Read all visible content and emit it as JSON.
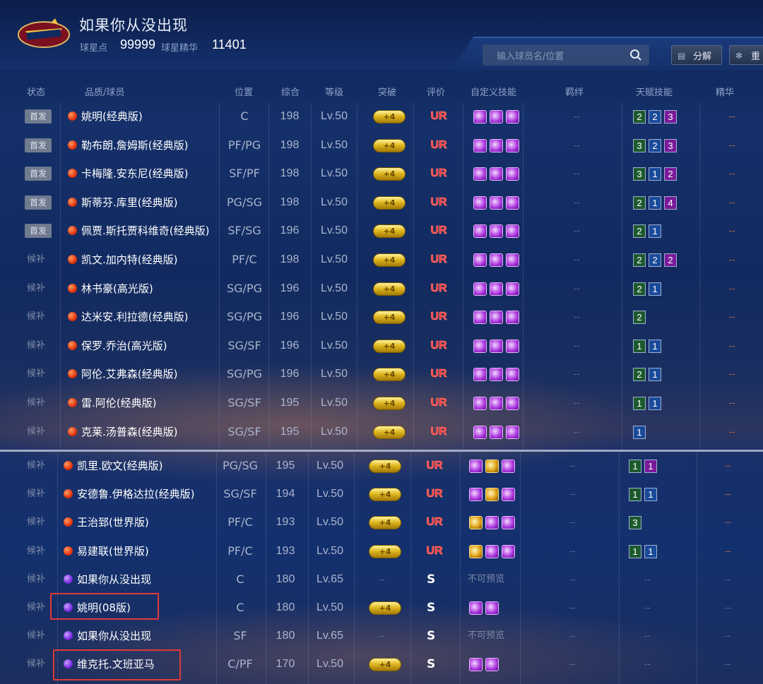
{
  "header": {
    "title": "如果你从没出现",
    "stars_label": "球星点",
    "stars_value": "99999",
    "essence_label": "球星精华",
    "essence_value": "11401",
    "search_placeholder": "输入球员名/位置",
    "decompose_label": "分解",
    "extra_label": "重"
  },
  "columns": [
    "状态",
    "品质/球员",
    "位置",
    "综合",
    "等级",
    "突破",
    "评价",
    "自定义技能",
    "羁绊",
    "天赋技能",
    "精华"
  ],
  "colors": {
    "ur": "#ff2a2a",
    "highlight": "#e03a3a"
  },
  "rows": [
    {
      "status": "首发",
      "start": true,
      "quality": "red",
      "name": "姚明(经典版)",
      "pos": "C",
      "ovr": "198",
      "lvl": "Lv.50",
      "brk": "+4",
      "grade": "UR",
      "skills": [
        "p",
        "p",
        "p"
      ],
      "bond": "--",
      "talents": [
        [
          "2",
          "g"
        ],
        [
          "2",
          "b"
        ],
        [
          "3",
          "p"
        ]
      ],
      "essence": "--"
    },
    {
      "status": "首发",
      "start": true,
      "quality": "red",
      "name": "勒布朗.詹姆斯(经典版)",
      "pos": "PF/PG",
      "ovr": "198",
      "lvl": "Lv.50",
      "brk": "+4",
      "grade": "UR",
      "skills": [
        "p",
        "p",
        "p"
      ],
      "bond": "--",
      "talents": [
        [
          "3",
          "g"
        ],
        [
          "2",
          "b"
        ],
        [
          "3",
          "p"
        ]
      ],
      "essence": "--"
    },
    {
      "status": "首发",
      "start": true,
      "quality": "red",
      "name": "卡梅隆.安东尼(经典版)",
      "pos": "SF/PF",
      "ovr": "198",
      "lvl": "Lv.50",
      "brk": "+4",
      "grade": "UR",
      "skills": [
        "p",
        "p",
        "p"
      ],
      "bond": "--",
      "talents": [
        [
          "3",
          "g"
        ],
        [
          "1",
          "b"
        ],
        [
          "2",
          "p"
        ]
      ],
      "essence": "--"
    },
    {
      "status": "首发",
      "start": true,
      "quality": "red",
      "name": "斯蒂芬.库里(经典版)",
      "pos": "PG/SG",
      "ovr": "198",
      "lvl": "Lv.50",
      "brk": "+4",
      "grade": "UR",
      "skills": [
        "p",
        "p",
        "p"
      ],
      "bond": "--",
      "talents": [
        [
          "2",
          "g"
        ],
        [
          "1",
          "b"
        ],
        [
          "4",
          "p"
        ]
      ],
      "essence": "--"
    },
    {
      "status": "首发",
      "start": true,
      "quality": "red",
      "name": "佩贾.斯托贾科维奇(经典版)",
      "pos": "SF/SG",
      "ovr": "196",
      "lvl": "Lv.50",
      "brk": "+4",
      "grade": "UR",
      "skills": [
        "p",
        "p",
        "p"
      ],
      "bond": "--",
      "talents": [
        [
          "2",
          "g"
        ],
        [
          "1",
          "b"
        ]
      ],
      "essence": "--"
    },
    {
      "status": "候补",
      "start": false,
      "quality": "red",
      "name": "凯文.加内特(经典版)",
      "pos": "PF/C",
      "ovr": "198",
      "lvl": "Lv.50",
      "brk": "+4",
      "grade": "UR",
      "skills": [
        "p",
        "p",
        "p"
      ],
      "bond": "--",
      "talents": [
        [
          "2",
          "g"
        ],
        [
          "2",
          "b"
        ],
        [
          "2",
          "p"
        ]
      ],
      "essence": "--"
    },
    {
      "status": "候补",
      "start": false,
      "quality": "red",
      "name": "林书豪(高光版)",
      "pos": "SG/PG",
      "ovr": "196",
      "lvl": "Lv.50",
      "brk": "+4",
      "grade": "UR",
      "skills": [
        "p",
        "p",
        "p"
      ],
      "bond": "--",
      "talents": [
        [
          "2",
          "g"
        ],
        [
          "1",
          "b"
        ]
      ],
      "essence": "--"
    },
    {
      "status": "候补",
      "start": false,
      "quality": "red",
      "name": "达米安.利拉德(经典版)",
      "pos": "SG/PG",
      "ovr": "196",
      "lvl": "Lv.50",
      "brk": "+4",
      "grade": "UR",
      "skills": [
        "p",
        "p",
        "p"
      ],
      "bond": "--",
      "talents": [
        [
          "2",
          "g"
        ]
      ],
      "essence": "--"
    },
    {
      "status": "候补",
      "start": false,
      "quality": "red",
      "name": "保罗.乔治(高光版)",
      "pos": "SG/SF",
      "ovr": "196",
      "lvl": "Lv.50",
      "brk": "+4",
      "grade": "UR",
      "skills": [
        "p",
        "p",
        "p"
      ],
      "bond": "--",
      "talents": [
        [
          "1",
          "g"
        ],
        [
          "1",
          "b"
        ]
      ],
      "essence": "--"
    },
    {
      "status": "候补",
      "start": false,
      "quality": "red",
      "name": "阿伦.艾弗森(经典版)",
      "pos": "SG/PG",
      "ovr": "196",
      "lvl": "Lv.50",
      "brk": "+4",
      "grade": "UR",
      "skills": [
        "p",
        "p",
        "p"
      ],
      "bond": "--",
      "talents": [
        [
          "2",
          "g"
        ],
        [
          "1",
          "b"
        ]
      ],
      "essence": "--"
    },
    {
      "status": "候补",
      "start": false,
      "quality": "red",
      "name": "雷.阿伦(经典版)",
      "pos": "SG/SF",
      "ovr": "195",
      "lvl": "Lv.50",
      "brk": "+4",
      "grade": "UR",
      "skills": [
        "p",
        "p",
        "p"
      ],
      "bond": "--",
      "talents": [
        [
          "1",
          "g"
        ],
        [
          "1",
          "b"
        ]
      ],
      "essence": "--"
    },
    {
      "status": "候补",
      "start": false,
      "quality": "red",
      "name": "克莱.汤普森(经典版)",
      "pos": "SG/SF",
      "ovr": "195",
      "lvl": "Lv.50",
      "brk": "+4",
      "grade": "UR",
      "skills": [
        "p",
        "p",
        "p"
      ],
      "bond": "--",
      "talents": [
        [
          "1",
          "b"
        ]
      ],
      "essence": "--"
    },
    {
      "status": "候补",
      "start": false,
      "quality": "red",
      "name": "凯里.欧文(经典版)",
      "pos": "PG/SG",
      "ovr": "195",
      "lvl": "Lv.50",
      "brk": "+4",
      "grade": "UR",
      "skills": [
        "p",
        "gold",
        "p"
      ],
      "bond": "--",
      "talents": [
        [
          "1",
          "g"
        ],
        [
          "1",
          "p"
        ]
      ],
      "essence": "--"
    },
    {
      "status": "候补",
      "start": false,
      "quality": "red",
      "name": "安德鲁.伊格达拉(经典版)",
      "pos": "SG/SF",
      "ovr": "194",
      "lvl": "Lv.50",
      "brk": "+4",
      "grade": "UR",
      "skills": [
        "p",
        "gold",
        "p"
      ],
      "bond": "--",
      "talents": [
        [
          "1",
          "g"
        ],
        [
          "1",
          "b"
        ]
      ],
      "essence": "--"
    },
    {
      "status": "候补",
      "start": false,
      "quality": "red",
      "name": "王治郅(世界版)",
      "pos": "PF/C",
      "ovr": "193",
      "lvl": "Lv.50",
      "brk": "+4",
      "grade": "UR",
      "skills": [
        "gold",
        "p",
        "p"
      ],
      "bond": "--",
      "talents": [
        [
          "3",
          "g"
        ]
      ],
      "essence": "--"
    },
    {
      "status": "候补",
      "start": false,
      "quality": "red",
      "name": "易建联(世界版)",
      "pos": "PF/C",
      "ovr": "193",
      "lvl": "Lv.50",
      "brk": "+4",
      "grade": "UR",
      "skills": [
        "gold",
        "p",
        "p"
      ],
      "bond": "--",
      "talents": [
        [
          "1",
          "g"
        ],
        [
          "1",
          "b"
        ]
      ],
      "essence": "--"
    },
    {
      "status": "候补",
      "start": false,
      "quality": "purple",
      "name": "如果你从没出现",
      "pos": "C",
      "ovr": "180",
      "lvl": "Lv.65",
      "brk": "--",
      "grade": "S",
      "skills_text": "不可预览",
      "skills": [],
      "bond": "--",
      "talents": [],
      "talent_text": "--",
      "essence": "--"
    },
    {
      "status": "候补",
      "start": false,
      "quality": "purple",
      "name": "姚明(08版)",
      "pos": "C",
      "ovr": "180",
      "lvl": "Lv.50",
      "brk": "+4",
      "grade": "S",
      "skills": [
        "p",
        "p"
      ],
      "bond": "--",
      "talents": [],
      "talent_text": "--",
      "essence": "--"
    },
    {
      "status": "候补",
      "start": false,
      "quality": "purple",
      "name": "如果你从没出现",
      "pos": "SF",
      "ovr": "180",
      "lvl": "Lv.65",
      "brk": "--",
      "grade": "S",
      "skills_text": "不可预览",
      "skills": [],
      "bond": "--",
      "talents": [],
      "talent_text": "--",
      "essence": "--"
    },
    {
      "status": "候补",
      "start": false,
      "quality": "purple",
      "name": "维克托.文班亚马",
      "pos": "C/PF",
      "ovr": "170",
      "lvl": "Lv.50",
      "brk": "+4",
      "grade": "S",
      "skills": [
        "p",
        "p"
      ],
      "bond": "--",
      "talents": [],
      "talent_text": "--",
      "essence": "--"
    }
  ]
}
